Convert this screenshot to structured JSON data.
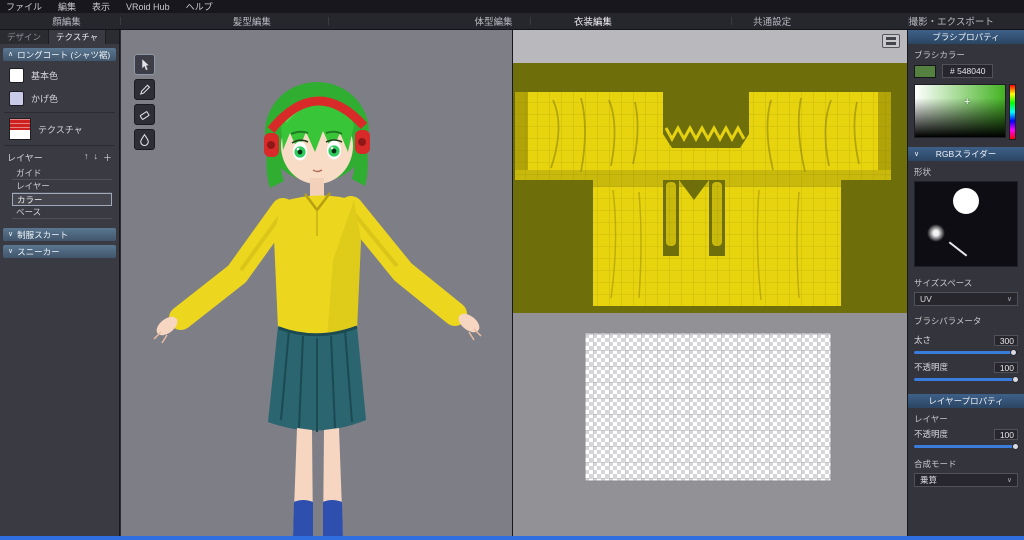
{
  "menu": {
    "items": [
      "ファイル",
      "編集",
      "表示",
      "VRoid Hub",
      "ヘルプ"
    ]
  },
  "main_tabs": {
    "items": [
      "顔編集",
      "髪型編集",
      "体型編集",
      "衣装編集",
      "共通設定",
      "撮影・エクスポート"
    ],
    "active": "衣装編集"
  },
  "sidebar": {
    "tabs": [
      {
        "label": "デザイン"
      },
      {
        "label": "テクスチャ"
      }
    ],
    "active_tab": "テクスチャ",
    "section_title": "ロングコート (シャツ裾)",
    "color_items": [
      {
        "label": "基本色",
        "color": "#ffffff"
      },
      {
        "label": "かげ色",
        "color": "#c9cbe8"
      },
      {
        "label": "テクスチャ",
        "color": "red-white-texture"
      }
    ],
    "layers_title": "レイヤー",
    "layer_items": [
      "ガイド",
      "レイヤー",
      "カラー",
      "ベース"
    ],
    "selected_layer": "カラー",
    "collapsed_sections": [
      "制服スカート",
      "スニーカー"
    ]
  },
  "tools": {
    "icons": [
      "select-cursor-icon",
      "pencil-icon",
      "eraser-icon",
      "paint-drop-icon"
    ],
    "active": "select-cursor-icon"
  },
  "brush_panel": {
    "title": "ブラシプロパティ",
    "color_label": "ブラシカラー",
    "hex": "# 548040",
    "swatch_color": "#548040",
    "rgb_slider_title": "RGBスライダー",
    "shape_label": "形状",
    "size_space_label": "サイズスペース",
    "size_space_value": "UV",
    "params_title": "ブラシパラメータ",
    "thickness_label": "太さ",
    "thickness_value": "300",
    "opacity_label": "不透明度",
    "opacity_value": "100"
  },
  "layer_panel": {
    "title": "レイヤープロパティ",
    "group_label": "レイヤー",
    "opacity_label": "不透明度",
    "opacity_value": "100",
    "blend_label": "合成モード",
    "blend_value": "乗算"
  },
  "icons": {
    "chevron_up": "∧",
    "chevron_down": "∨",
    "up": "↑",
    "down": "↓",
    "plus": "＋"
  },
  "colors": {
    "accent_blue": "#2e6ee0",
    "header_blue": "#34506f",
    "viewport_gray": "#7e7e86",
    "texture_olive": "#6e6e0a",
    "texture_yellow": "#e8d40e",
    "hair_green": "#38c538",
    "headphone_red": "#d92a2a",
    "shirt_yellow": "#ecd71e",
    "skirt_teal": "#2a6570",
    "sock_blue": "#2e4fae"
  }
}
